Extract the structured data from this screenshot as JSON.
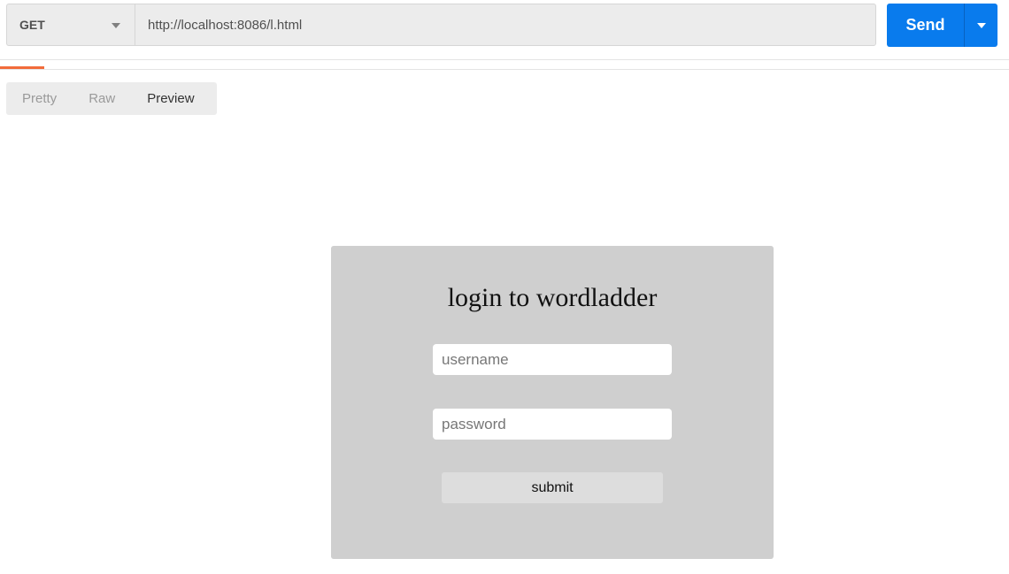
{
  "request": {
    "method": "GET",
    "url": "http://localhost:8086/l.html",
    "send_label": "Send"
  },
  "response_view": {
    "options": [
      "Pretty",
      "Raw",
      "Preview"
    ],
    "active": "Preview"
  },
  "preview": {
    "title": "login to wordladder",
    "username_placeholder": "username",
    "password_placeholder": "password",
    "submit_label": "submit"
  },
  "colors": {
    "send_button": "#097bed",
    "active_tab_underline": "#f26b3a",
    "card_background": "#cfcfcf"
  },
  "icons": {
    "method_dropdown": "chevron-down-icon",
    "send_dropdown": "chevron-down-icon"
  }
}
